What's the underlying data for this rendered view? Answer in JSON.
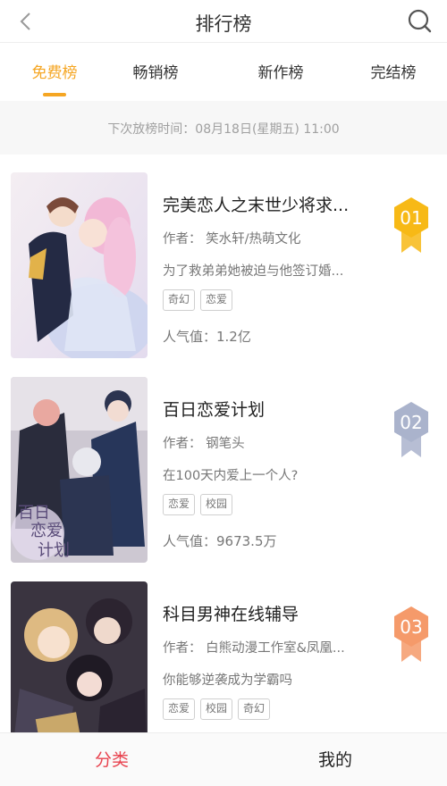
{
  "header": {
    "title": "排行榜"
  },
  "tabs": [
    {
      "label": "免费榜"
    },
    {
      "label": "畅销榜"
    },
    {
      "label": "新作榜"
    },
    {
      "label": "完结榜"
    }
  ],
  "notice": {
    "text": "下次放榜时间：08月18日(星期五) 11:00"
  },
  "books": [
    {
      "title": "完美恋人之末世少将求...",
      "author": "作者：  笑水轩/热萌文化",
      "description": "为了救弟弟她被迫与他签订婚...",
      "tags": [
        "奇幻",
        "恋爱"
      ],
      "popularity": "人气值：1.2亿",
      "rank": "01",
      "rank_color": "#f7b916"
    },
    {
      "title": "百日恋爱计划",
      "author": "作者：  钢笔头",
      "description": "在100天内爱上一个人?",
      "tags": [
        "恋爱",
        "校园"
      ],
      "popularity": "人气值：9673.5万",
      "rank": "02",
      "rank_color": "#aab3cc"
    },
    {
      "title": "科目男神在线辅导",
      "author": "作者：  白熊动漫工作室&凤凰...",
      "description": "你能够逆袭成为学霸吗",
      "tags": [
        "恋爱",
        "校园",
        "奇幻"
      ],
      "popularity": "",
      "rank": "03",
      "rank_color": "#f59a6a"
    }
  ],
  "cover2_text": [
    "百日",
    "恋爱",
    "计划"
  ],
  "bottom_nav": [
    {
      "label": "分类"
    },
    {
      "label": "我的"
    }
  ],
  "colors": {
    "accent": "#f5a623",
    "nav_active": "#e8434f"
  }
}
